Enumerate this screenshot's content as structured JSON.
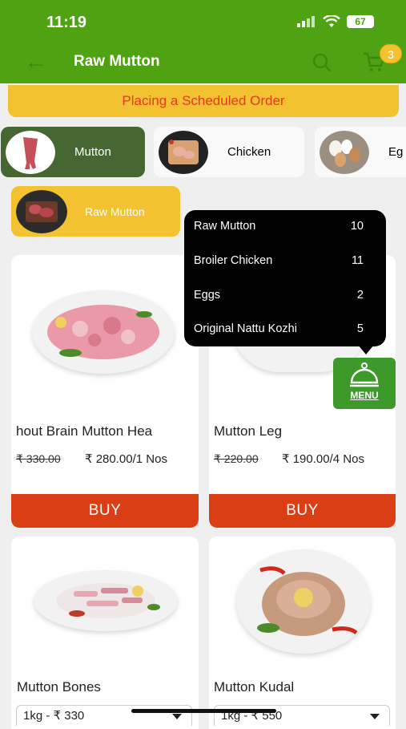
{
  "status": {
    "time": "11:19",
    "battery": "67"
  },
  "header": {
    "title": "Raw Mutton",
    "cart_count": "3"
  },
  "banner": {
    "text": "Placing a Scheduled Order"
  },
  "categories": [
    {
      "label": "Mutton",
      "selected": true
    },
    {
      "label": "Chicken",
      "selected": false
    },
    {
      "label": "Eg",
      "selected": false
    }
  ],
  "subcategory": {
    "label": "Raw Mutton"
  },
  "products": [
    {
      "name": "hout Brain    Mutton Hea",
      "old_price": "₹ 330.00",
      "price": "₹ 280.00/1 Nos",
      "buy_label": "BUY"
    },
    {
      "name": "Mutton Leg",
      "old_price": "₹ 220.00",
      "price": "₹ 190.00/4 Nos",
      "buy_label": "BUY"
    },
    {
      "name": "Mutton Bones",
      "select_value": "1kg - ₹ 330"
    },
    {
      "name": "Mutton Kudal",
      "select_value": "1kg - ₹ 550"
    }
  ],
  "menu_popup": {
    "items": [
      {
        "label": "Raw Mutton",
        "count": "10"
      },
      {
        "label": "Broiler Chicken",
        "count": "11"
      },
      {
        "label": "Eggs",
        "count": "2"
      },
      {
        "label": "Original Nattu Kozhi",
        "count": "5"
      }
    ],
    "button_label": "MENU"
  },
  "colors": {
    "brand_green": "#4fa313",
    "accent_yellow": "#f2c230",
    "buy_red": "#d93e14"
  }
}
